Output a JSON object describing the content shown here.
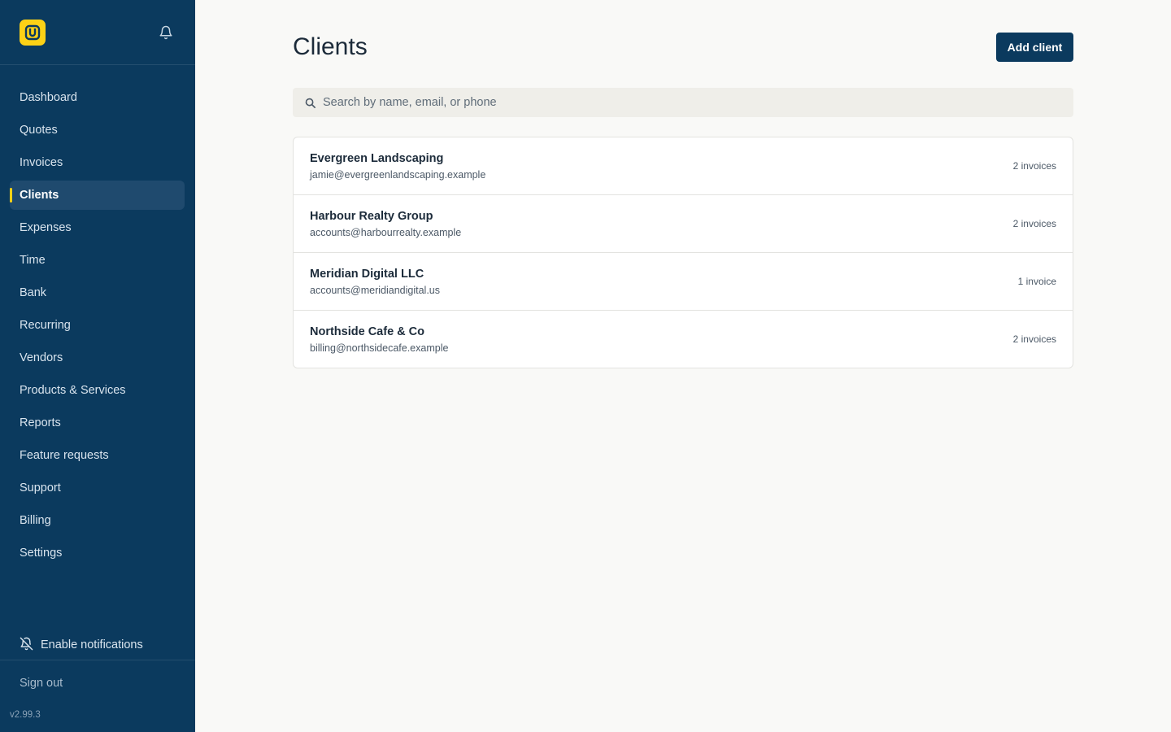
{
  "app": {
    "version": "v2.99.3",
    "colors": {
      "sidebar": "#0b3a5e",
      "accent": "#fcd116",
      "primary_button": "#0b3a5e"
    }
  },
  "sidebar": {
    "logo_icon": "u-logo-icon",
    "bell_icon": "bell-icon",
    "items": [
      {
        "label": "Dashboard",
        "active": false
      },
      {
        "label": "Quotes",
        "active": false
      },
      {
        "label": "Invoices",
        "active": false
      },
      {
        "label": "Clients",
        "active": true
      },
      {
        "label": "Expenses",
        "active": false
      },
      {
        "label": "Time",
        "active": false
      },
      {
        "label": "Bank",
        "active": false
      },
      {
        "label": "Recurring",
        "active": false
      },
      {
        "label": "Vendors",
        "active": false
      },
      {
        "label": "Products & Services",
        "active": false
      },
      {
        "label": "Reports",
        "active": false
      },
      {
        "label": "Feature requests",
        "active": false
      },
      {
        "label": "Support",
        "active": false
      },
      {
        "label": "Billing",
        "active": false
      },
      {
        "label": "Settings",
        "active": false
      }
    ],
    "enable_notifications_label": "Enable notifications",
    "sign_out_label": "Sign out"
  },
  "main": {
    "title": "Clients",
    "add_button_label": "Add client",
    "search": {
      "placeholder": "Search by name, email, or phone",
      "value": ""
    },
    "clients": [
      {
        "name": "Evergreen Landscaping",
        "email": "jamie@evergreenlandscaping.example",
        "invoices": "2 invoices"
      },
      {
        "name": "Harbour Realty Group",
        "email": "accounts@harbourrealty.example",
        "invoices": "2 invoices"
      },
      {
        "name": "Meridian Digital LLC",
        "email": "accounts@meridiandigital.us",
        "invoices": "1 invoice"
      },
      {
        "name": "Northside Cafe & Co",
        "email": "billing@northsidecafe.example",
        "invoices": "2 invoices"
      }
    ]
  }
}
